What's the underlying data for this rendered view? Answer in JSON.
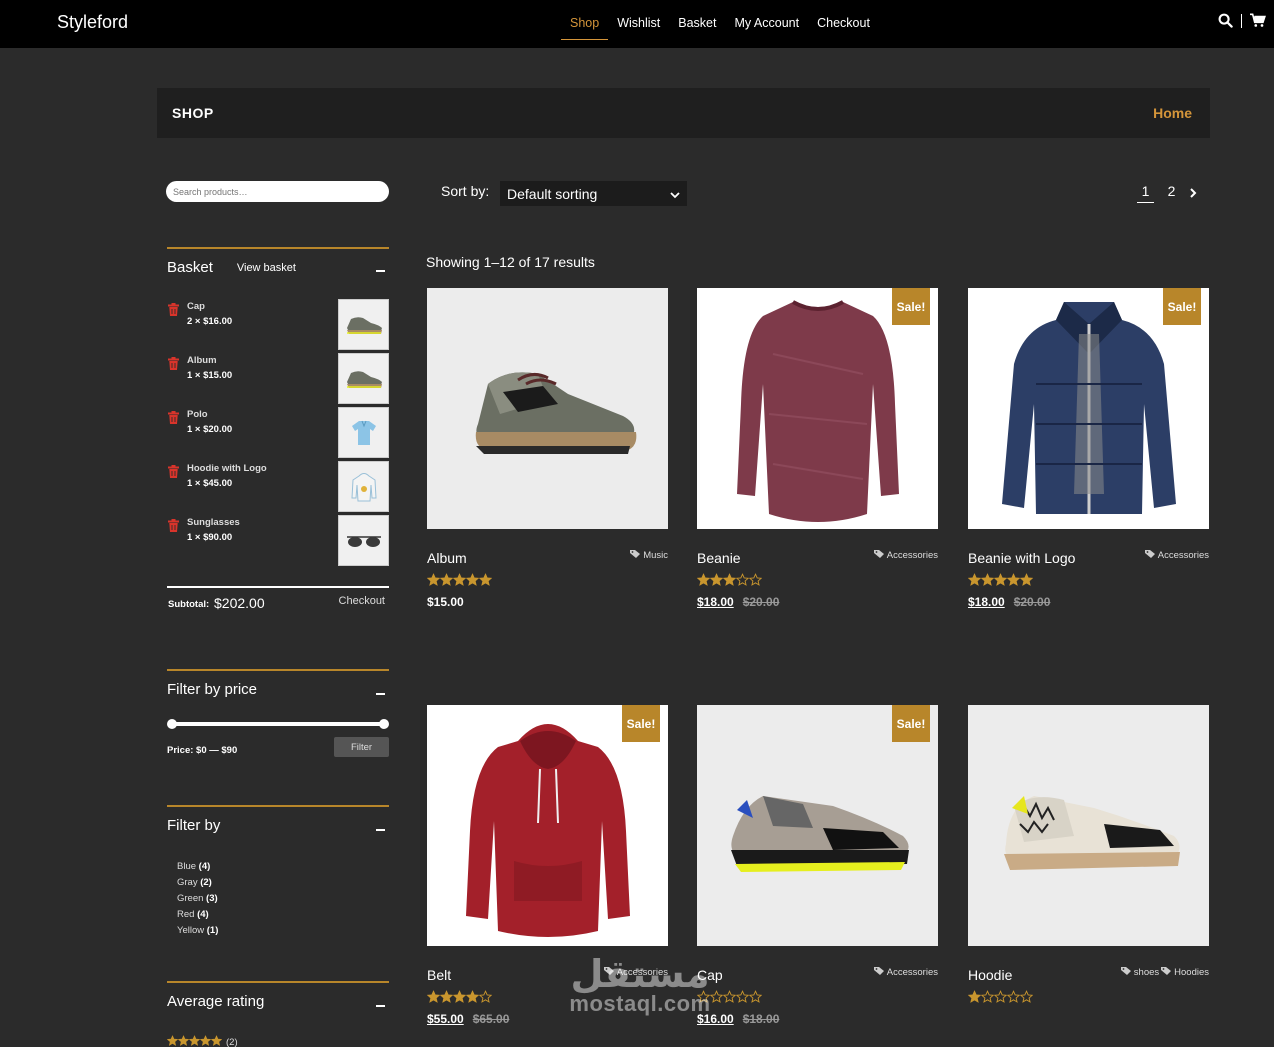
{
  "header": {
    "brand": "Styleford",
    "nav": [
      "Shop",
      "Wishlist",
      "Basket",
      "My Account",
      "Checkout"
    ],
    "active_nav": "Shop"
  },
  "shop_header": {
    "title": "SHOP",
    "breadcrumb": "Home"
  },
  "search": {
    "placeholder": "Search products…"
  },
  "basket": {
    "title": "Basket",
    "view_link": "View basket",
    "items": [
      {
        "name": "Cap",
        "qty": "2 × $16.00",
        "icon": "sneaker-thumb"
      },
      {
        "name": "Album",
        "qty": "1 × $15.00",
        "icon": "sneaker-thumb"
      },
      {
        "name": "Polo",
        "qty": "1 × $20.00",
        "icon": "polo-thumb"
      },
      {
        "name": "Hoodie with Logo",
        "qty": "1 × $45.00",
        "icon": "hoodie-thumb"
      },
      {
        "name": "Sunglasses",
        "qty": "1 × $90.00",
        "icon": "sunglasses-thumb"
      }
    ],
    "subtotal_label": "Subtotal:",
    "subtotal_value": "$202.00",
    "checkout": "Checkout"
  },
  "price_filter": {
    "title": "Filter by price",
    "label": "Price: $0 — $90",
    "button": "Filter",
    "range_min_fraction": 0,
    "range_max_fraction": 1
  },
  "attr_filter": {
    "title": "Filter by",
    "options": [
      {
        "label": "Blue",
        "count": "(4)"
      },
      {
        "label": "Gray",
        "count": "(2)"
      },
      {
        "label": "Green",
        "count": "(3)"
      },
      {
        "label": "Red",
        "count": "(4)"
      },
      {
        "label": "Yellow",
        "count": "(1)"
      }
    ]
  },
  "rating_filter": {
    "title": "Average rating",
    "stars": 5,
    "count": "(2)"
  },
  "toolbar": {
    "sort_label": "Sort by:",
    "sort_value": "Default sorting",
    "pages": [
      "1",
      "2"
    ],
    "current_page": "1",
    "results": "Showing 1–12 of 17 results"
  },
  "products": [
    {
      "name": "Album",
      "category": "Music",
      "rating": 5,
      "price": "$15.00",
      "old_price": "",
      "sale": false,
      "image": "sneaker-green"
    },
    {
      "name": "Beanie",
      "category": "Accessories",
      "rating": 3,
      "price": "$18.00",
      "old_price": "$20.00",
      "sale": true,
      "image": "longsleeve-maroon"
    },
    {
      "name": "Beanie with Logo",
      "category": "Accessories",
      "rating": 5,
      "price": "$18.00",
      "old_price": "$20.00",
      "sale": true,
      "image": "jacket-navy"
    },
    {
      "name": "Belt",
      "category": "Accessories",
      "rating": 4,
      "price": "$55.00",
      "old_price": "$65.00",
      "sale": true,
      "image": "hoodie-red"
    },
    {
      "name": "Cap",
      "category": "Accessories",
      "rating": 0,
      "price": "$16.00",
      "old_price": "$18.00",
      "sale": true,
      "image": "sneaker-yellow"
    },
    {
      "name": "Hoodie",
      "category": "shoes",
      "category2": "Hoodies",
      "rating": 1,
      "price": "",
      "old_price": "",
      "sale": false,
      "image": "sneaker-pattern"
    }
  ],
  "sale_label": "Sale!",
  "watermark": {
    "arabic": "مستقل",
    "latin": "mostaql.com"
  },
  "colors": {
    "accent": "#d4953a",
    "gold": "#b8862a",
    "bg": "#2b2b2b",
    "topbar": "#000000",
    "star": "#c9962e"
  }
}
